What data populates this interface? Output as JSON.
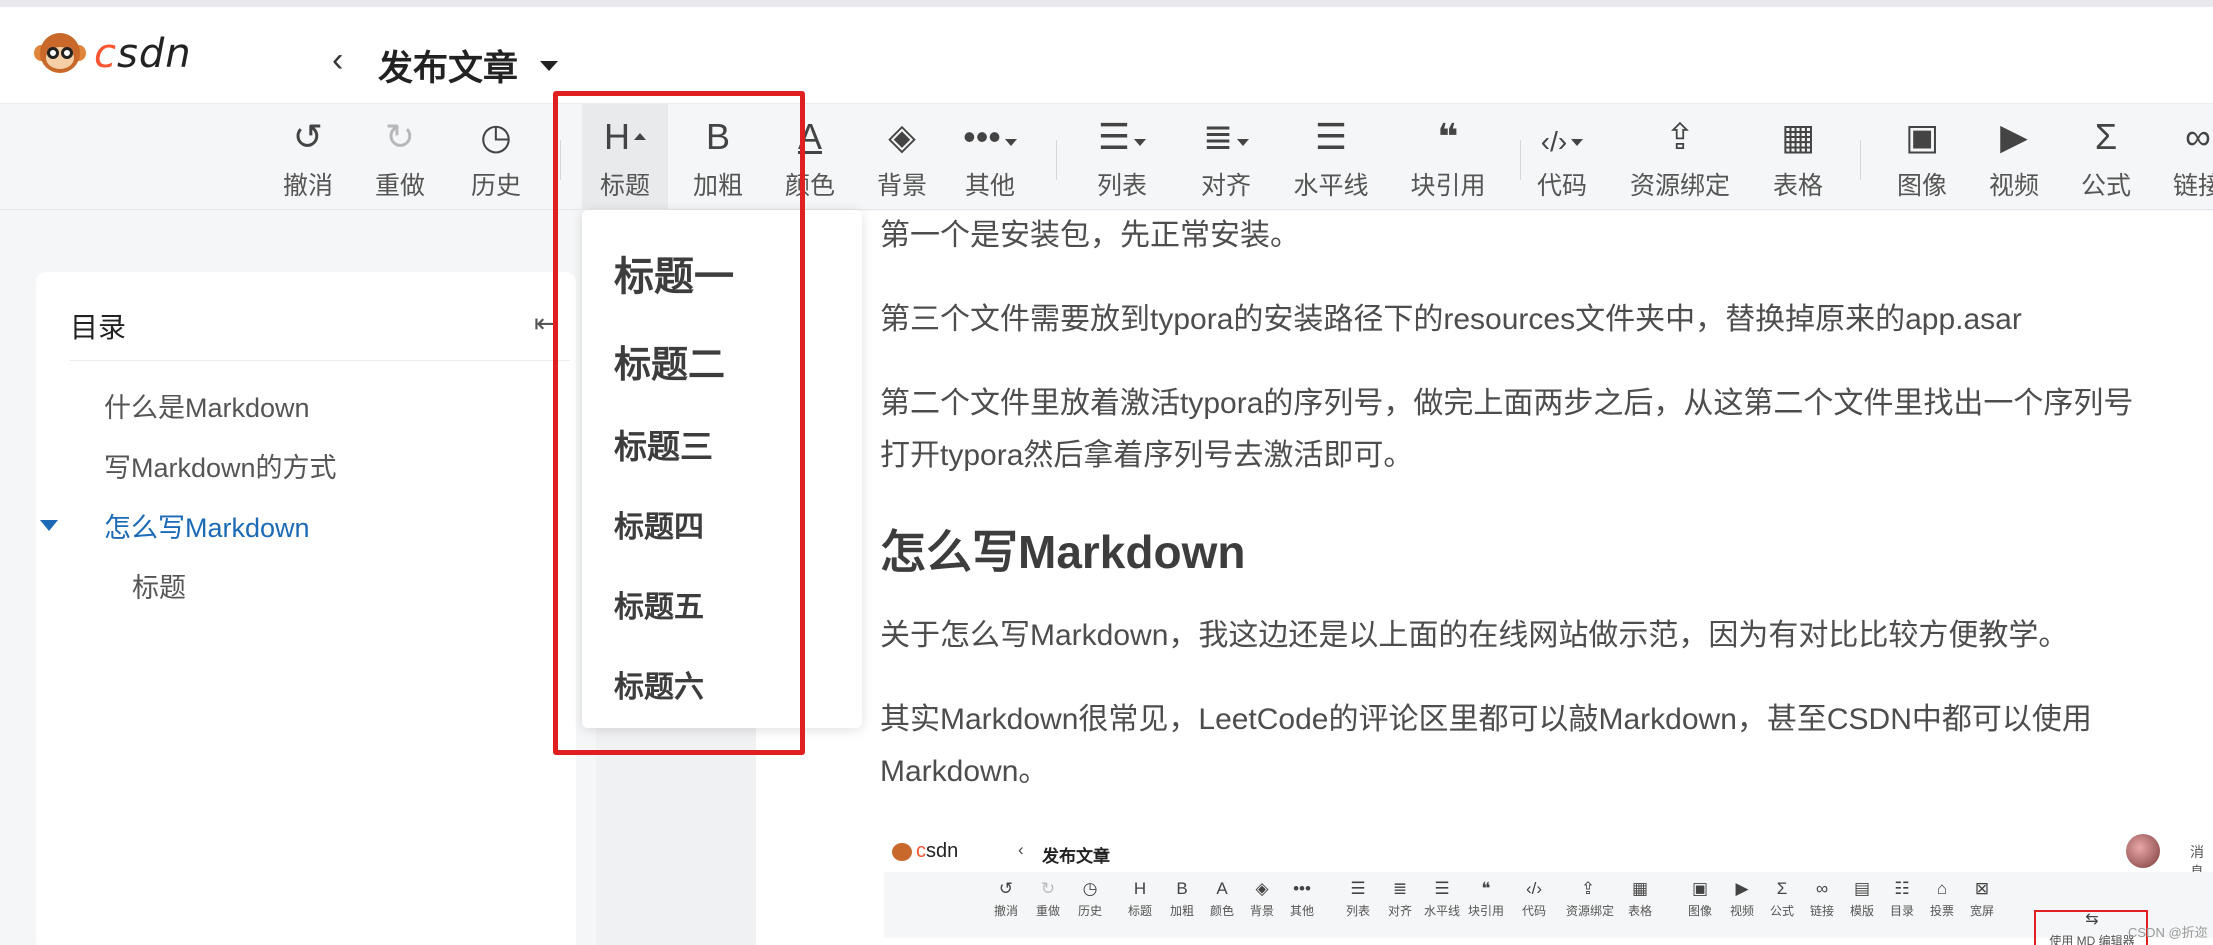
{
  "header": {
    "logo_text": "CSDN",
    "back_icon": "chevron-left-icon",
    "title": "发布文章"
  },
  "toolbar": {
    "items": [
      {
        "label": "撤消",
        "icon": "undo-icon"
      },
      {
        "label": "重做",
        "icon": "redo-icon"
      },
      {
        "label": "历史",
        "icon": "history-icon"
      },
      {
        "label": "标题",
        "icon": "heading-icon"
      },
      {
        "label": "加粗",
        "icon": "bold-icon"
      },
      {
        "label": "颜色",
        "icon": "text-color-icon"
      },
      {
        "label": "背景",
        "icon": "background-fill-icon"
      },
      {
        "label": "其他",
        "icon": "more-icon"
      },
      {
        "label": "列表",
        "icon": "list-icon"
      },
      {
        "label": "对齐",
        "icon": "align-icon"
      },
      {
        "label": "水平线",
        "icon": "horizontal-rule-icon"
      },
      {
        "label": "块引用",
        "icon": "blockquote-icon"
      },
      {
        "label": "代码",
        "icon": "code-icon"
      },
      {
        "label": "资源绑定",
        "icon": "resource-bind-icon"
      },
      {
        "label": "表格",
        "icon": "table-icon"
      },
      {
        "label": "图像",
        "icon": "image-icon"
      },
      {
        "label": "视频",
        "icon": "video-icon"
      },
      {
        "label": "公式",
        "icon": "formula-icon"
      },
      {
        "label": "链接",
        "icon": "link-icon"
      }
    ]
  },
  "heading_menu": {
    "items": [
      "标题一",
      "标题二",
      "标题三",
      "标题四",
      "标题五",
      "标题六"
    ]
  },
  "toc": {
    "title": "目录",
    "items": [
      {
        "label": "什么是Markdown"
      },
      {
        "label": "写Markdown的方式"
      },
      {
        "label": "怎么写Markdown"
      },
      {
        "label": "标题"
      }
    ]
  },
  "content": {
    "p1": "第一个是安装包，先正常安装。",
    "p2": "第三个文件需要放到typora的安装路径下的resources文件夹中，替换掉原来的app.asar",
    "p3_line1": "第二个文件里放着激活typora的序列号，做完上面两步之后，从这第二个文件里找出一个序列号",
    "p3_line2": "打开typora然后拿着序列号去激活即可。",
    "h2": "怎么写Markdown",
    "p4": "关于怎么写Markdown，我这边还是以上面的在线网站做示范，因为有对比比较方便教学。",
    "p5_line1": "其实Markdown很常见，LeetCode的评论区里都可以敲Markdown，甚至CSDN中都可以使用",
    "p5_line2": "Markdown。"
  },
  "embedded_screenshot": {
    "logo_text": "CSDN",
    "title": "发布文章",
    "msg": "消息",
    "tools": [
      "撤消",
      "重做",
      "历史",
      "标题",
      "加粗",
      "颜色",
      "背景",
      "其他",
      "列表",
      "对齐",
      "水平线",
      "块引用",
      "代码",
      "资源绑定",
      "表格",
      "图像",
      "视频",
      "公式",
      "链接",
      "模版",
      "目录",
      "投票",
      "宽屏"
    ],
    "md_button": "使用 MD 编辑器",
    "watermark": "CSDN @折迩"
  },
  "colors": {
    "brand": "#fc5531",
    "highlight_red": "#e02020",
    "toc_active": "#1c6ab6"
  }
}
